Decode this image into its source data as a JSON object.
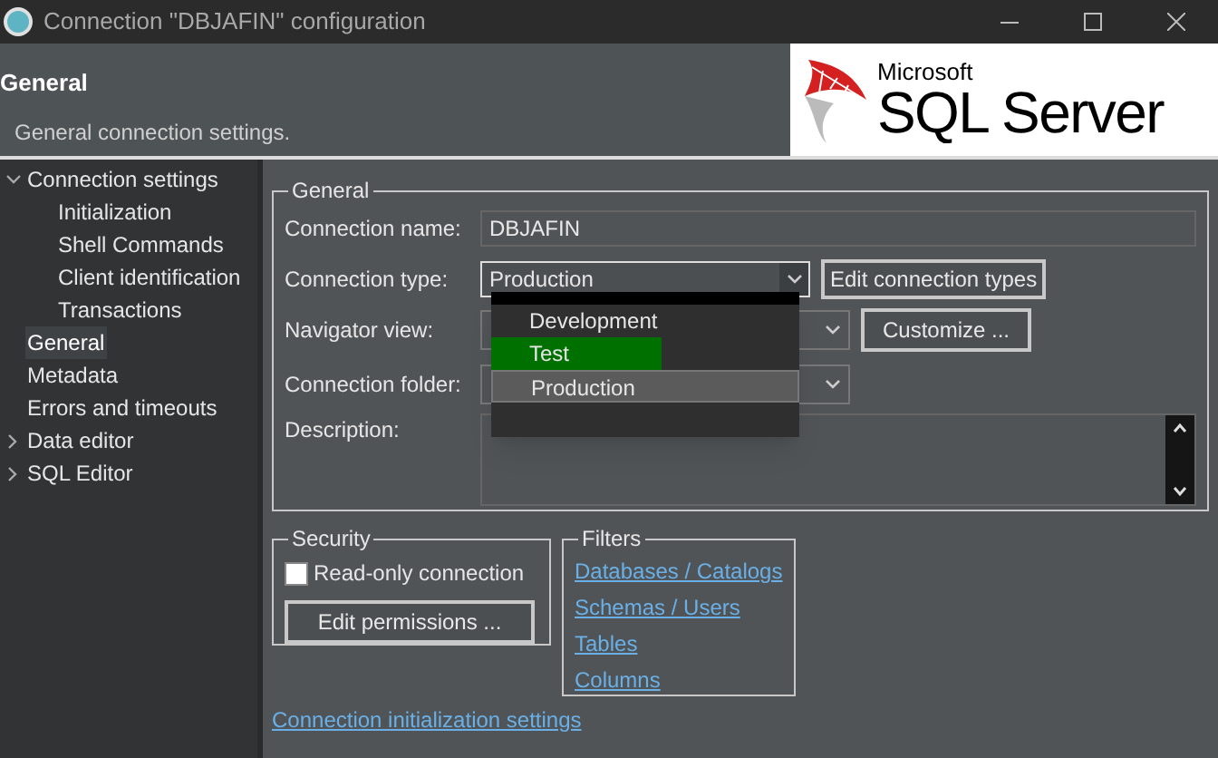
{
  "window": {
    "title": "Connection \"DBJAFIN\" configuration"
  },
  "header": {
    "title": "General",
    "subtitle": "General connection settings.",
    "logo": {
      "small": "Microsoft",
      "large": "SQL Server"
    }
  },
  "sidebar": {
    "items": [
      {
        "label": "Connection settings",
        "expanded": true,
        "selected": false,
        "children": [
          {
            "label": "Initialization",
            "selected": false
          },
          {
            "label": "Shell Commands",
            "selected": false
          },
          {
            "label": "Client identification",
            "selected": false
          },
          {
            "label": "Transactions",
            "selected": false
          }
        ]
      },
      {
        "label": "General",
        "selected": true
      },
      {
        "label": "Metadata",
        "selected": false
      },
      {
        "label": "Errors and timeouts",
        "selected": false
      },
      {
        "label": "Data editor",
        "expanded": false,
        "selected": false
      },
      {
        "label": "SQL Editor",
        "expanded": false,
        "selected": false
      }
    ]
  },
  "general": {
    "title": "General",
    "connection_name": {
      "label": "Connection name:",
      "value": "DBJAFIN"
    },
    "connection_type": {
      "label": "Connection type:",
      "value": "Production",
      "button": "Edit connection types",
      "options": [
        {
          "label": "Development",
          "selected": false
        },
        {
          "label": "Test",
          "selected": false,
          "color": "#007000"
        },
        {
          "label": "Production",
          "selected": true
        }
      ]
    },
    "navigator_view": {
      "label": "Navigator view:",
      "button": "Customize ..."
    },
    "connection_folder": {
      "label": "Connection folder:"
    },
    "description": {
      "label": "Description:"
    }
  },
  "security": {
    "title": "Security",
    "read_only": {
      "label": "Read-only connection",
      "checked": false
    },
    "button": "Edit permissions ..."
  },
  "filters": {
    "title": "Filters",
    "links": [
      "Databases / Catalogs",
      "Schemas / Users",
      "Tables",
      "Columns"
    ]
  },
  "footer_link": "Connection initialization settings"
}
